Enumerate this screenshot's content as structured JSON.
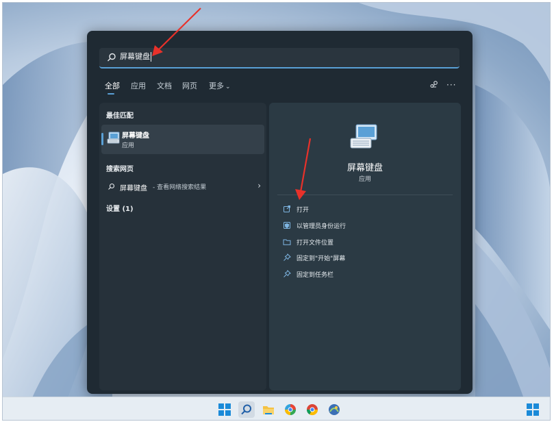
{
  "search": {
    "query": "屏幕键盘"
  },
  "tabs": [
    {
      "label": "全部"
    },
    {
      "label": "应用"
    },
    {
      "label": "文档"
    },
    {
      "label": "网页"
    },
    {
      "label": "更多"
    }
  ],
  "left": {
    "best_match_header": "最佳匹配",
    "best_match": {
      "title": "屏幕键盘",
      "subtitle": "应用"
    },
    "web_header": "搜索网页",
    "web_result": {
      "query": "屏幕键盘",
      "suffix": " - 查看网络搜索结果"
    },
    "settings_header": "设置 (1)"
  },
  "right": {
    "app_title": "屏幕键盘",
    "app_type": "应用",
    "actions": [
      {
        "label": "打开",
        "icon": "open-icon"
      },
      {
        "label": "以管理员身份运行",
        "icon": "admin-shield-icon"
      },
      {
        "label": "打开文件位置",
        "icon": "folder-icon"
      },
      {
        "label": "固定到\"开始\"屏幕",
        "icon": "pin-icon"
      },
      {
        "label": "固定到任务栏",
        "icon": "pin-icon"
      }
    ]
  },
  "taskbar": {
    "items": [
      "windows-start-icon",
      "search-icon",
      "file-explorer-icon",
      "edge-icon",
      "chrome-icon",
      "app-icon"
    ],
    "accent": "#5aa0d6"
  },
  "colors": {
    "panel": "#1f2a33",
    "accent": "#5aa0d6",
    "arrow": "#e8312a"
  }
}
